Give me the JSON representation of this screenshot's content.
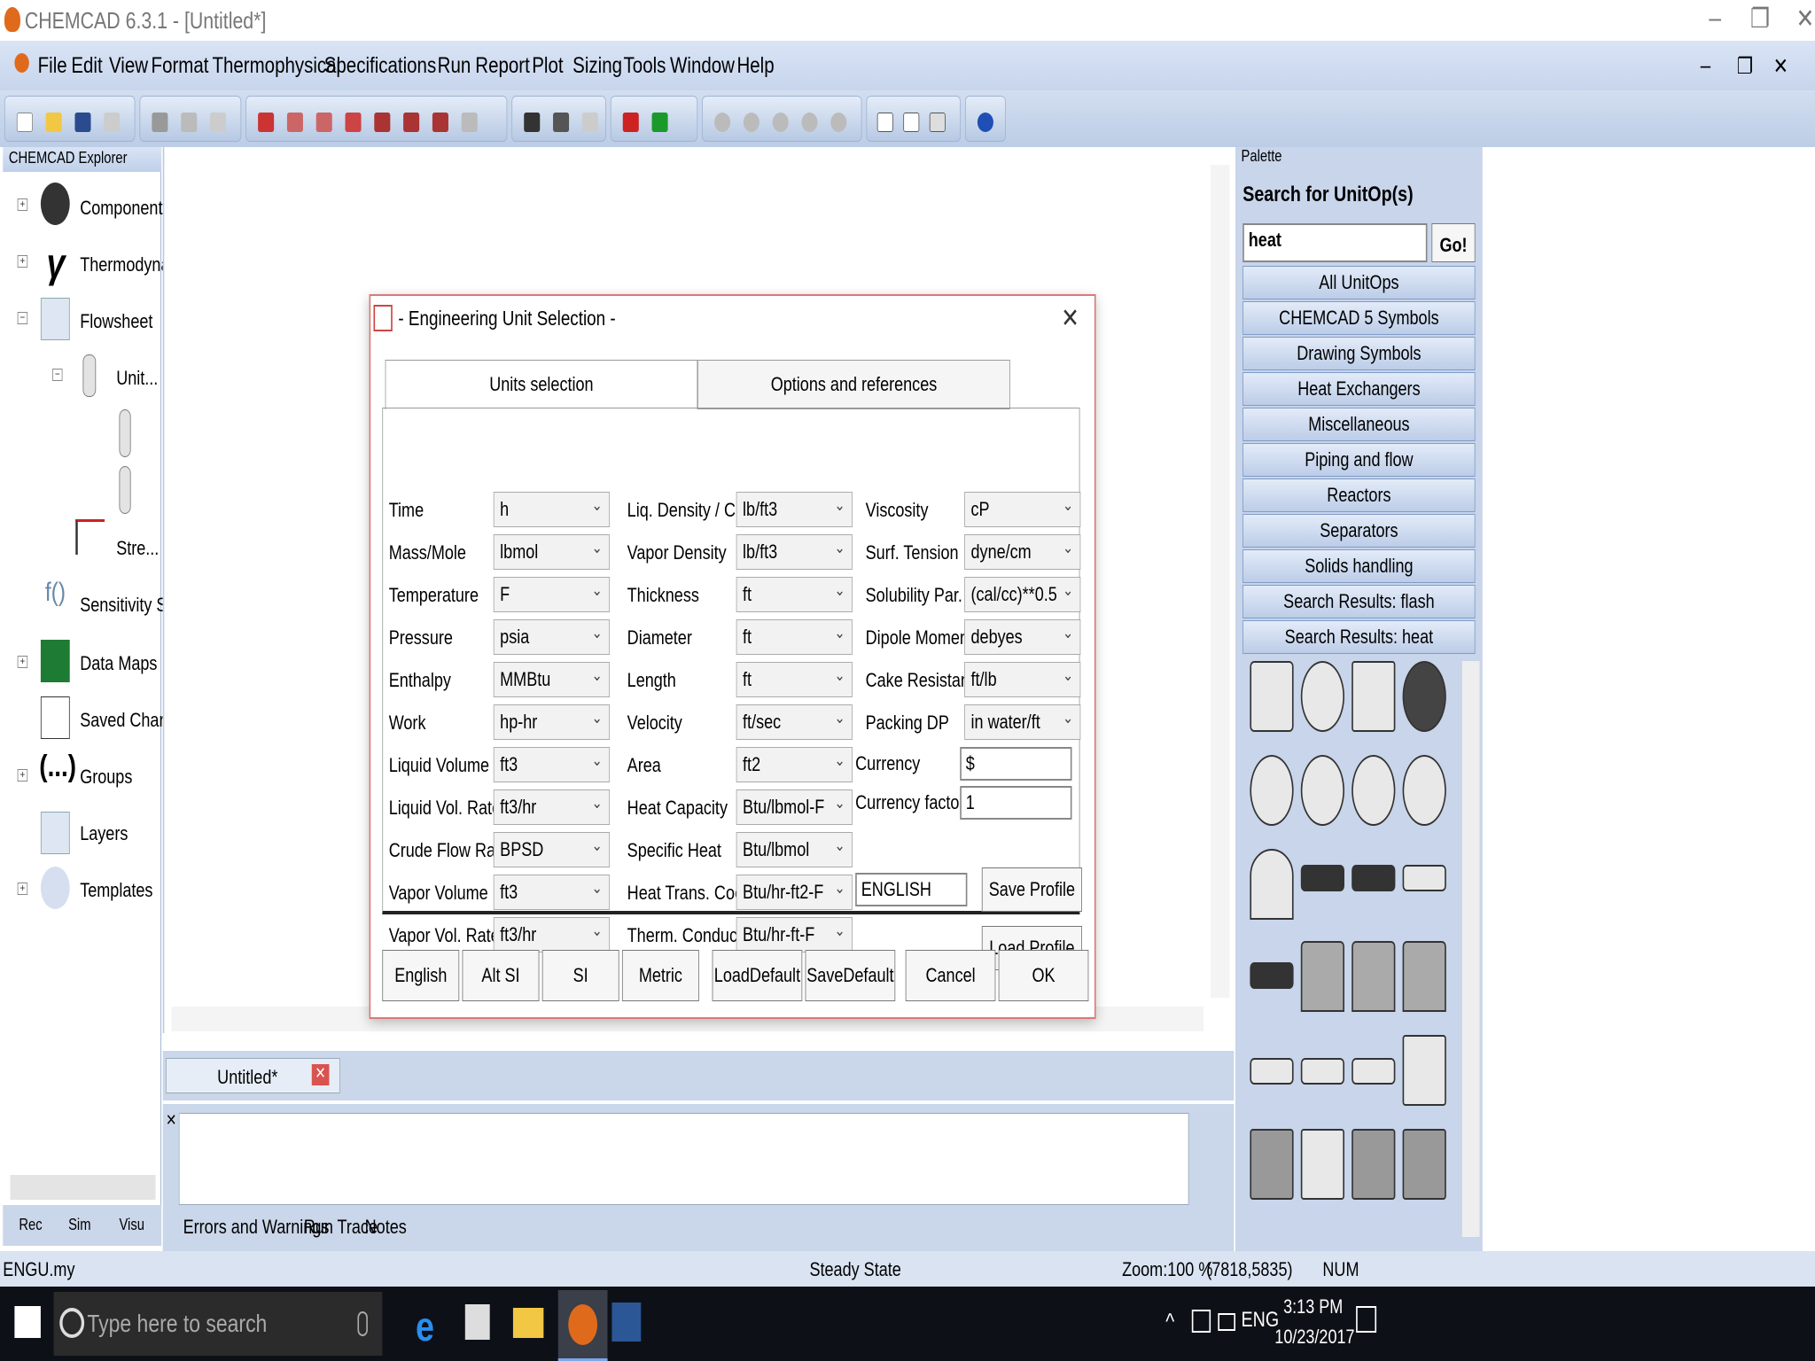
{
  "window": {
    "title": "CHEMCAD 6.3.1 - [Untitled*]"
  },
  "menu": [
    "File",
    "Edit",
    "View",
    "Format",
    "Thermophysical",
    "Specifications",
    "Run",
    "Report",
    "Plot",
    "Sizing",
    "Tools",
    "Window",
    "Help"
  ],
  "explorer": {
    "title": "CHEMCAD Explorer",
    "items": [
      "Components",
      "Thermodyna...",
      "Flowsheet",
      "Unit...",
      "Stre...",
      "Sensitivity Stu...",
      "Data Maps",
      "Saved Charts",
      "Groups",
      "Layers",
      "Templates"
    ],
    "bottom_tabs": [
      "Rec",
      "Sim",
      "Visu"
    ]
  },
  "palette": {
    "title": "Palette",
    "search_label": "Search for UnitOp(s)",
    "search_value": "heat",
    "go": "Go!",
    "buttons": [
      "All UnitOps",
      "CHEMCAD 5 Symbols",
      "Drawing Symbols",
      "Heat Exchangers",
      "Miscellaneous",
      "Piping and flow",
      "Reactors",
      "Separators",
      "Solids handling",
      "Search Results: flash",
      "Search Results: heat"
    ]
  },
  "doc_tab": "Untitled*",
  "bottom_tabs": [
    "Errors and Warnings",
    "Run Trace",
    "Notes"
  ],
  "dialog": {
    "title": "- Engineering Unit Selection -",
    "tabs": [
      "Units selection",
      "Options and references"
    ],
    "col1": [
      [
        "Time",
        "h"
      ],
      [
        "Mass/Mole",
        "lbmol"
      ],
      [
        "Temperature",
        "F"
      ],
      [
        "Pressure",
        "psia"
      ],
      [
        "Enthalpy",
        "MMBtu"
      ],
      [
        "Work",
        "hp-hr"
      ],
      [
        "Liquid Volume",
        "ft3"
      ],
      [
        "Liquid Vol. Rate",
        "ft3/hr"
      ],
      [
        "Crude Flow Rate",
        "BPSD"
      ],
      [
        "Vapor Volume",
        "ft3"
      ],
      [
        "Vapor Vol. Rate",
        "ft3/hr"
      ]
    ],
    "col2": [
      [
        "Liq. Density / Conc.",
        "lb/ft3"
      ],
      [
        "Vapor Density",
        "lb/ft3"
      ],
      [
        "Thickness",
        "ft"
      ],
      [
        "Diameter",
        "ft"
      ],
      [
        "Length",
        "ft"
      ],
      [
        "Velocity",
        "ft/sec"
      ],
      [
        "Area",
        "ft2"
      ],
      [
        "Heat Capacity",
        "Btu/lbmol-F"
      ],
      [
        "Specific Heat",
        "Btu/lbmol"
      ],
      [
        "Heat Trans. Coeff.",
        "Btu/hr-ft2-F"
      ],
      [
        "Therm. Conduct.",
        "Btu/hr-ft-F"
      ]
    ],
    "col3": [
      [
        "Viscosity",
        "cP"
      ],
      [
        "Surf. Tension",
        "dyne/cm"
      ],
      [
        "Solubility Par.",
        "(cal/cc)**0.5"
      ],
      [
        "Dipole Moment",
        "debyes"
      ],
      [
        "Cake Resistance",
        "ft/lb"
      ],
      [
        "Packing DP",
        "in water/ft"
      ]
    ],
    "currency_label": "Currency",
    "currency_value": "$",
    "factor_label": "Currency factor",
    "factor_value": "1",
    "profile_value": "ENGLISH",
    "save_profile": "Save Profile",
    "load_profile": "Load Profile",
    "buttons": [
      "English",
      "Alt SI",
      "SI",
      "Metric",
      "LoadDefault",
      "SaveDefault",
      "Cancel",
      "OK"
    ]
  },
  "status": {
    "file": "ENGU.my",
    "mode": "Steady State",
    "zoom": "Zoom:100 %",
    "coords": "(7818,5835)",
    "num": "NUM"
  },
  "taskbar": {
    "search": "Type here to search",
    "lang": "ENG",
    "time": "3:13 PM",
    "date": "10/23/2017"
  }
}
